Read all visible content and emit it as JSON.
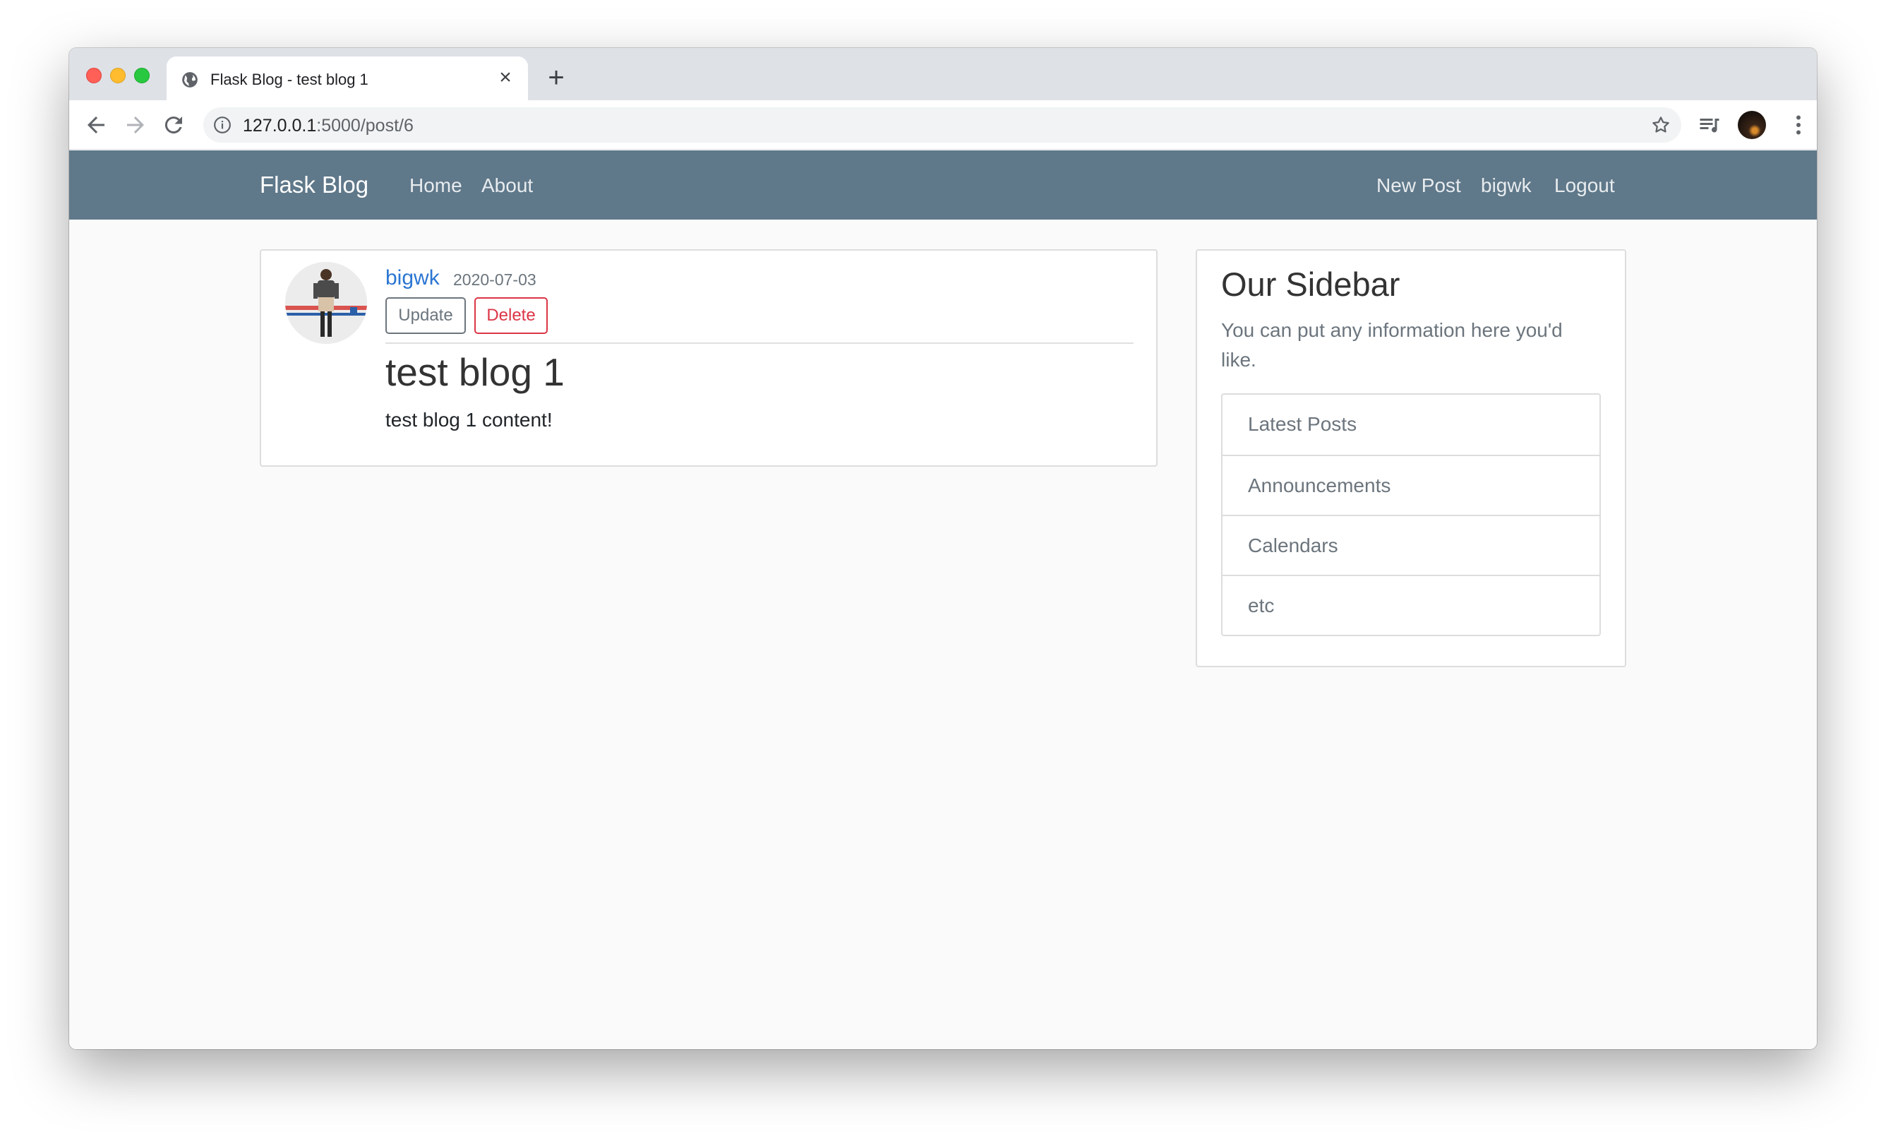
{
  "browser": {
    "tab_title": "Flask Blog - test blog 1",
    "url_host": "127.0.0.1",
    "url_rest": ":5000/post/6",
    "icons": [
      "globe-icon",
      "close-icon",
      "plus-icon",
      "back-icon",
      "forward-icon",
      "reload-icon",
      "info-icon",
      "star-icon",
      "media-queue-icon",
      "profile-avatar",
      "more-icon"
    ]
  },
  "navbar": {
    "brand": "Flask Blog",
    "left_links": [
      "Home",
      "About"
    ],
    "right_links": [
      "New Post",
      "bigwk",
      "Logout"
    ],
    "background": "#5f788a"
  },
  "post": {
    "author": "bigwk",
    "date": "2020-07-03",
    "update_label": "Update",
    "delete_label": "Delete",
    "title": "test blog 1",
    "content": "test blog 1 content!"
  },
  "sidebar": {
    "title": "Our Sidebar",
    "description": "You can put any information here you'd like.",
    "items": [
      "Latest Posts",
      "Announcements",
      "Calendars",
      "etc"
    ]
  }
}
